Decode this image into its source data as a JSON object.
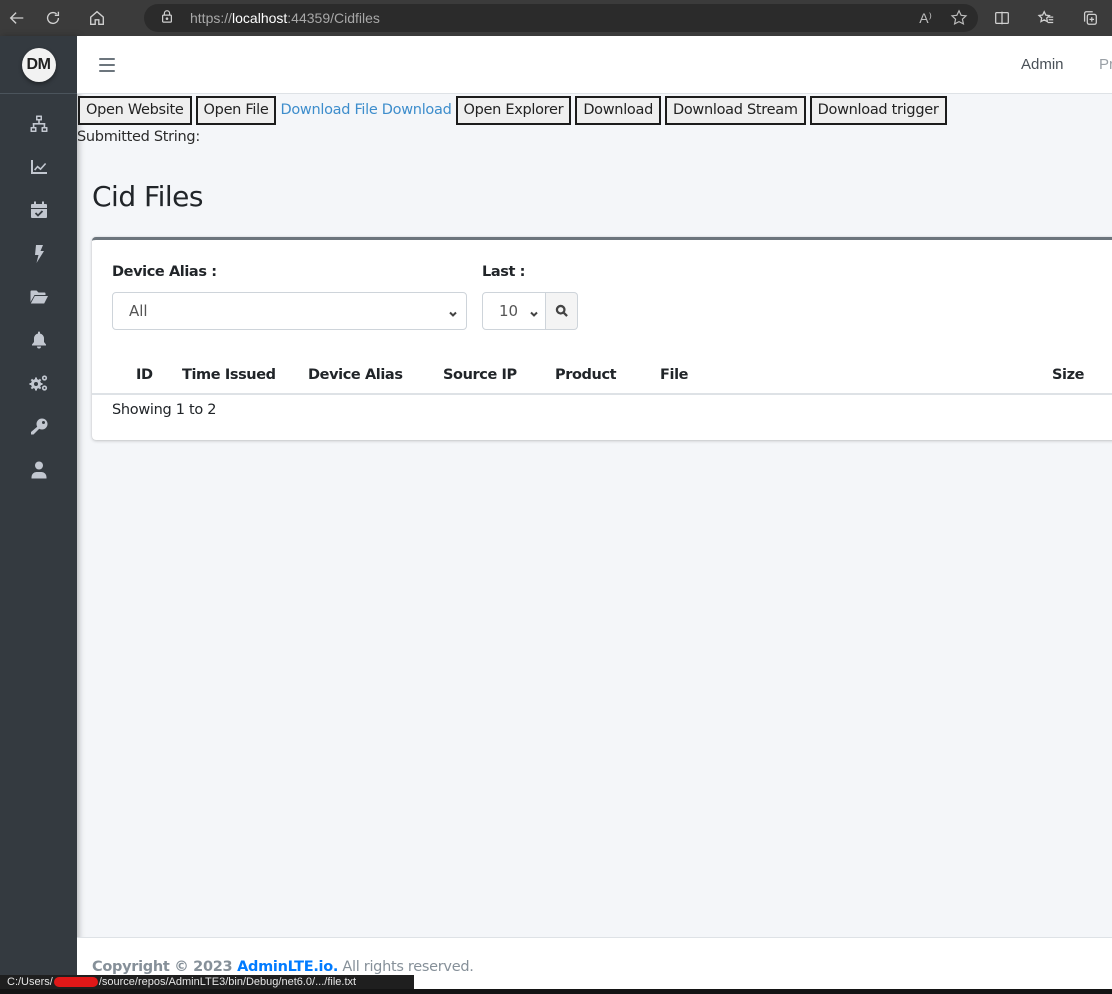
{
  "browser": {
    "url_scheme": "https://",
    "url_host": "localhost",
    "url_rest": ":44359/Cidfiles",
    "read_aloud_label": "A⁾"
  },
  "sidebar": {
    "avatar_initials": "DM",
    "items": [
      {
        "icon": "network-icon",
        "label": "Network"
      },
      {
        "icon": "chart-line-icon",
        "label": "Charts"
      },
      {
        "icon": "calendar-check-icon",
        "label": "Calendar"
      },
      {
        "icon": "bolt-icon",
        "label": "Events"
      },
      {
        "icon": "folder-open-icon",
        "label": "Files"
      },
      {
        "icon": "bell-icon",
        "label": "Notifications"
      },
      {
        "icon": "cogs-icon",
        "label": "Settings"
      },
      {
        "icon": "key-icon",
        "label": "Keys"
      },
      {
        "icon": "user-icon",
        "label": "User"
      }
    ]
  },
  "topnav": {
    "admin_label": "Admin",
    "profile_label": "Pr"
  },
  "toolbar": {
    "open_website": "Open Website",
    "open_file": "Open File",
    "download_file_link": "Download File Download",
    "open_explorer": "Open Explorer",
    "download": "Download",
    "download_stream": "Download Stream",
    "download_trigger": "Download trigger"
  },
  "submitted_string_label": "Submitted String:",
  "page_title": "Cid Files",
  "filters": {
    "device_alias_label": "Device Alias :",
    "device_alias_value": "All",
    "last_label": "Last :",
    "last_value": "10"
  },
  "table": {
    "columns": [
      "ID",
      "Time Issued",
      "Device Alias",
      "Source IP",
      "Product",
      "File",
      "Size"
    ],
    "rows": [],
    "info": "Showing 1 to 2"
  },
  "footer": {
    "prefix": "Copyright © 2023 ",
    "brand": "AdminLTE.io.",
    "suffix": " All rights reserved."
  },
  "statusbar": {
    "path_start": "C:/Users/",
    "path_end": "/source/repos/AdminLTE3/bin/Debug/net6.0/.../file.txt"
  }
}
